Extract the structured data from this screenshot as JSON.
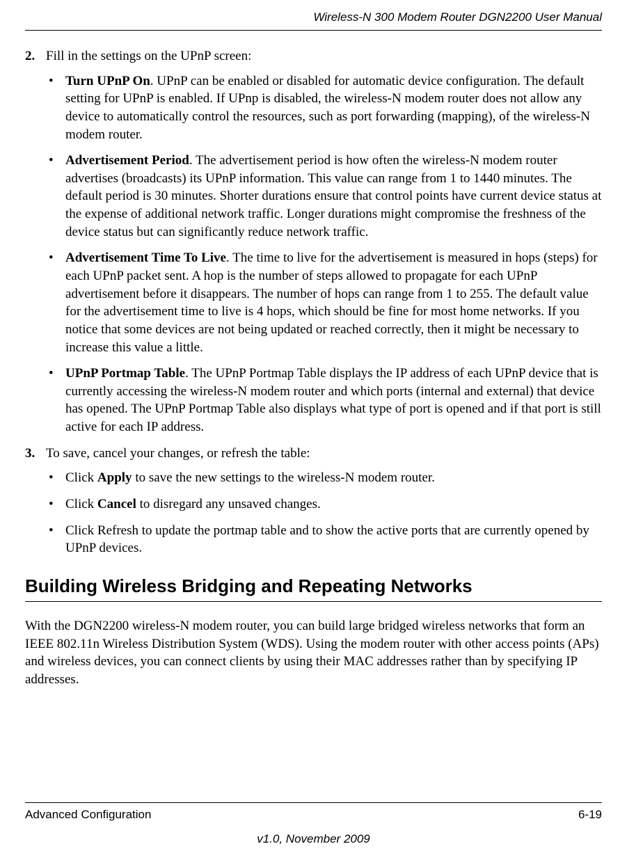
{
  "header": {
    "title": "Wireless-N 300 Modem Router DGN2200 User Manual"
  },
  "step2": {
    "num": "2.",
    "text": "Fill in the settings on the UPnP screen:",
    "bullets": [
      {
        "bold": "Turn UPnP On",
        "rest": ". UPnP can be enabled or disabled for automatic device configuration. The default setting for UPnP is enabled. If UPnp is disabled, the wireless-N modem router does not allow any device to automatically control the resources, such as port forwarding (mapping), of the wireless-N modem router."
      },
      {
        "bold": "Advertisement Period",
        "rest": ". The advertisement period is how often the wireless-N modem router advertises (broadcasts) its UPnP information. This value can range from 1 to 1440 minutes. The default period is 30 minutes. Shorter durations ensure that control points have current device status at the expense of additional network traffic. Longer durations might compromise the freshness of the device status but can significantly reduce network traffic."
      },
      {
        "bold": "Advertisement Time To Live",
        "rest": ". The time to live for the advertisement is measured in hops (steps) for each UPnP packet sent. A hop is the number of steps allowed to propagate for each UPnP advertisement before it disappears. The number of hops can range from 1 to 255. The default value for the advertisement time to live is 4 hops, which should be fine for most home networks. If you notice that some devices are not being updated or reached correctly, then it might be necessary to increase this value a little."
      },
      {
        "bold": "UPnP Portmap Table",
        "rest": ". The UPnP Portmap Table displays the IP address of each UPnP device that is currently accessing the wireless-N modem router and which ports (internal and external) that device has opened. The UPnP Portmap Table also displays what type of port is opened and if that port is still active for each IP address."
      }
    ]
  },
  "step3": {
    "num": "3.",
    "text": "To save, cancel your changes, or refresh the table:",
    "bullets": [
      {
        "pre": "Click ",
        "bold": "Apply",
        "rest": " to save the new settings to the wireless-N modem router."
      },
      {
        "pre": "Click ",
        "bold": "Cancel",
        "rest": " to disregard any unsaved changes."
      },
      {
        "pre": "",
        "bold": "",
        "rest": "Click Refresh to update the portmap table and to show the active ports that are currently opened by UPnP devices."
      }
    ]
  },
  "section": {
    "heading": "Building Wireless Bridging and Repeating Networks",
    "para": "With the DGN2200 wireless-N modem router, you can build large bridged wireless networks that form an IEEE 802.11n Wireless Distribution System (WDS). Using the modem router with other access points (APs) and wireless devices, you can connect clients by using their MAC addresses rather than by specifying IP addresses."
  },
  "footer": {
    "left": "Advanced Configuration",
    "right": "6-19",
    "version": "v1.0, November 2009"
  }
}
